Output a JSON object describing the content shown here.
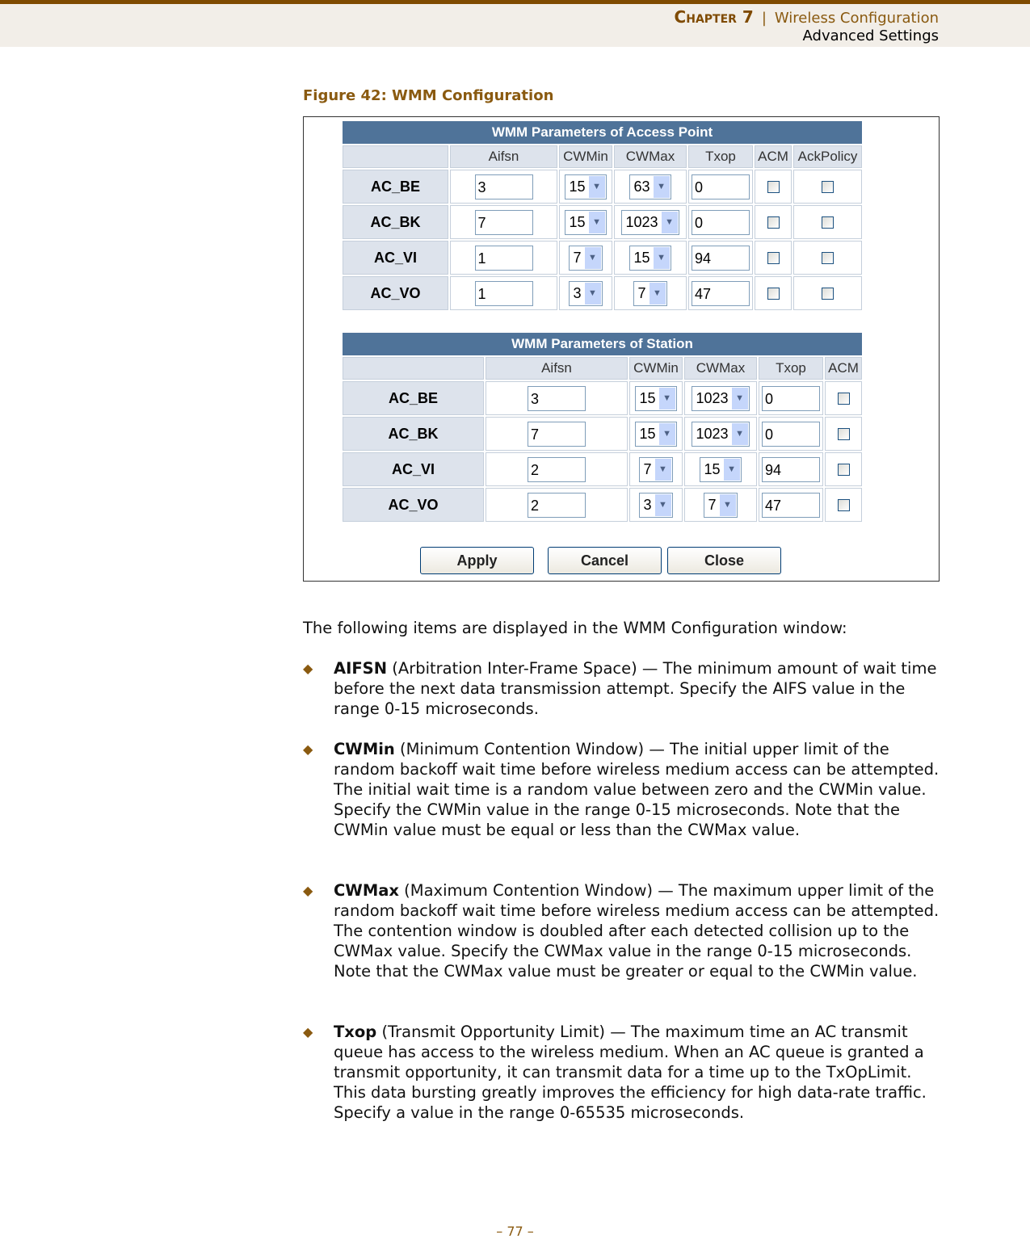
{
  "header": {
    "chapter": "Chapter 7",
    "separator": "|",
    "section": "Wireless Configuration",
    "subsection": "Advanced Settings"
  },
  "figure_caption": "Figure 42:  WMM Configuration",
  "ap_table": {
    "title": "WMM Parameters of Access Point",
    "columns": [
      "",
      "Aifsn",
      "CWMin",
      "CWMax",
      "Txop",
      "ACM",
      "AckPolicy"
    ],
    "rows": [
      {
        "label": "AC_BE",
        "aifsn": "3",
        "cwmin": "15",
        "cwmax": "63",
        "txop": "0",
        "acm": false,
        "ack": false
      },
      {
        "label": "AC_BK",
        "aifsn": "7",
        "cwmin": "15",
        "cwmax": "1023",
        "txop": "0",
        "acm": false,
        "ack": false
      },
      {
        "label": "AC_VI",
        "aifsn": "1",
        "cwmin": "7",
        "cwmax": "15",
        "txop": "94",
        "acm": false,
        "ack": false
      },
      {
        "label": "AC_VO",
        "aifsn": "1",
        "cwmin": "3",
        "cwmax": "7",
        "txop": "47",
        "acm": false,
        "ack": false
      }
    ]
  },
  "sta_table": {
    "title": "WMM Parameters of Station",
    "columns": [
      "",
      "Aifsn",
      "CWMin",
      "CWMax",
      "Txop",
      "ACM"
    ],
    "rows": [
      {
        "label": "AC_BE",
        "aifsn": "3",
        "cwmin": "15",
        "cwmax": "1023",
        "txop": "0",
        "acm": false
      },
      {
        "label": "AC_BK",
        "aifsn": "7",
        "cwmin": "15",
        "cwmax": "1023",
        "txop": "0",
        "acm": false
      },
      {
        "label": "AC_VI",
        "aifsn": "2",
        "cwmin": "7",
        "cwmax": "15",
        "txop": "94",
        "acm": false
      },
      {
        "label": "AC_VO",
        "aifsn": "2",
        "cwmin": "3",
        "cwmax": "7",
        "txop": "47",
        "acm": false
      }
    ]
  },
  "buttons": {
    "apply": "Apply",
    "cancel": "Cancel",
    "close": "Close"
  },
  "intro": "The following items are displayed in the WMM Configuration window:",
  "bullets": [
    {
      "term": "AIFSN",
      "text": " (Arbitration Inter-Frame Space) — The minimum amount of wait time before the next data transmission attempt. Specify the AIFS value in the range 0-15 microseconds."
    },
    {
      "term": "CWMin",
      "text": " (Minimum Contention Window) — The initial upper limit of the random backoff wait time before wireless medium access can be attempted. The initial wait time is a random value between zero and the CWMin value. Specify the CWMin value in the range 0-15 microseconds. Note that the CWMin value must be equal or less than the CWMax value."
    },
    {
      "term": "CWMax",
      "text": " (Maximum Contention Window) — The maximum upper limit of the random backoff wait time before wireless medium access can be attempted. The contention window is doubled after each detected collision up to the CWMax value. Specify the CWMax value in the range 0-15 microseconds. Note that the CWMax value must be greater or equal to the CWMin value."
    },
    {
      "term": "Txop",
      "text": " (Transmit Opportunity Limit) — The maximum time an AC transmit queue has access to the wireless medium. When an AC queue is granted a transmit opportunity, it can transmit data for a time up to the TxOpLimit. This data bursting greatly improves the efficiency for high data-rate traffic. Specify a value in the range 0-65535 microseconds."
    }
  ],
  "page_number": "–  77  –"
}
